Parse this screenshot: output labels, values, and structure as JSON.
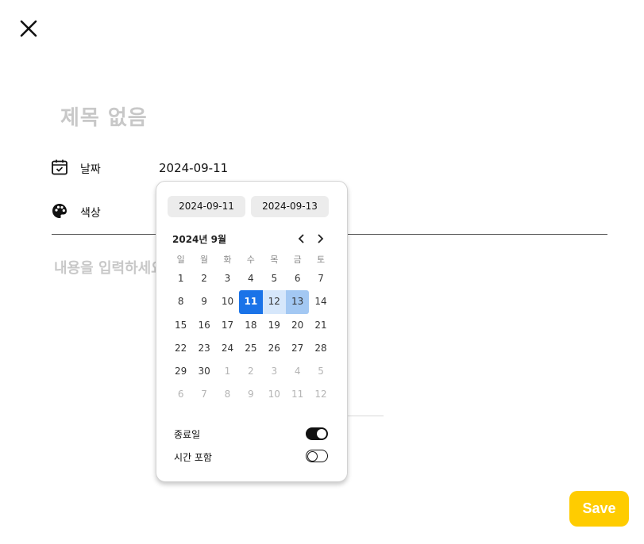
{
  "header": {
    "close_icon": "close-icon"
  },
  "title_placeholder": "제목 없음",
  "date_row": {
    "label": "날짜",
    "value": "2024-09-11",
    "icon": "calendar-check-icon"
  },
  "color_row": {
    "label": "색상",
    "icon": "palette-icon"
  },
  "content_placeholder": "내용을 입력하세요",
  "date_picker": {
    "start_date": "2024-09-11",
    "end_date": "2024-09-13",
    "month_label": "2024년 9월",
    "prev_icon": "chevron-left-icon",
    "next_icon": "chevron-right-icon",
    "weekdays": [
      "일",
      "월",
      "화",
      "수",
      "목",
      "금",
      "토"
    ],
    "weeks": [
      [
        "1",
        "2",
        "3",
        "4",
        "5",
        "6",
        "7"
      ],
      [
        "8",
        "9",
        "10",
        "11",
        "12",
        "13",
        "14"
      ],
      [
        "15",
        "16",
        "17",
        "18",
        "19",
        "20",
        "21"
      ],
      [
        "22",
        "23",
        "24",
        "25",
        "26",
        "27",
        "28"
      ],
      [
        "29",
        "30",
        "1",
        "2",
        "3",
        "4",
        "5"
      ],
      [
        "6",
        "7",
        "8",
        "9",
        "10",
        "11",
        "12"
      ]
    ],
    "selected_start_day": "11",
    "selected_end_day": "13",
    "end_date_toggle": {
      "label": "종료일",
      "on": true
    },
    "include_time_toggle": {
      "label": "시간 포함",
      "on": false
    }
  },
  "save_button": {
    "label": "Save",
    "color": "#ffcc00"
  },
  "colors": {
    "selected_day": "#1a73e8",
    "range_day": "#d6e7fb",
    "end_day": "#a3c8f3"
  }
}
